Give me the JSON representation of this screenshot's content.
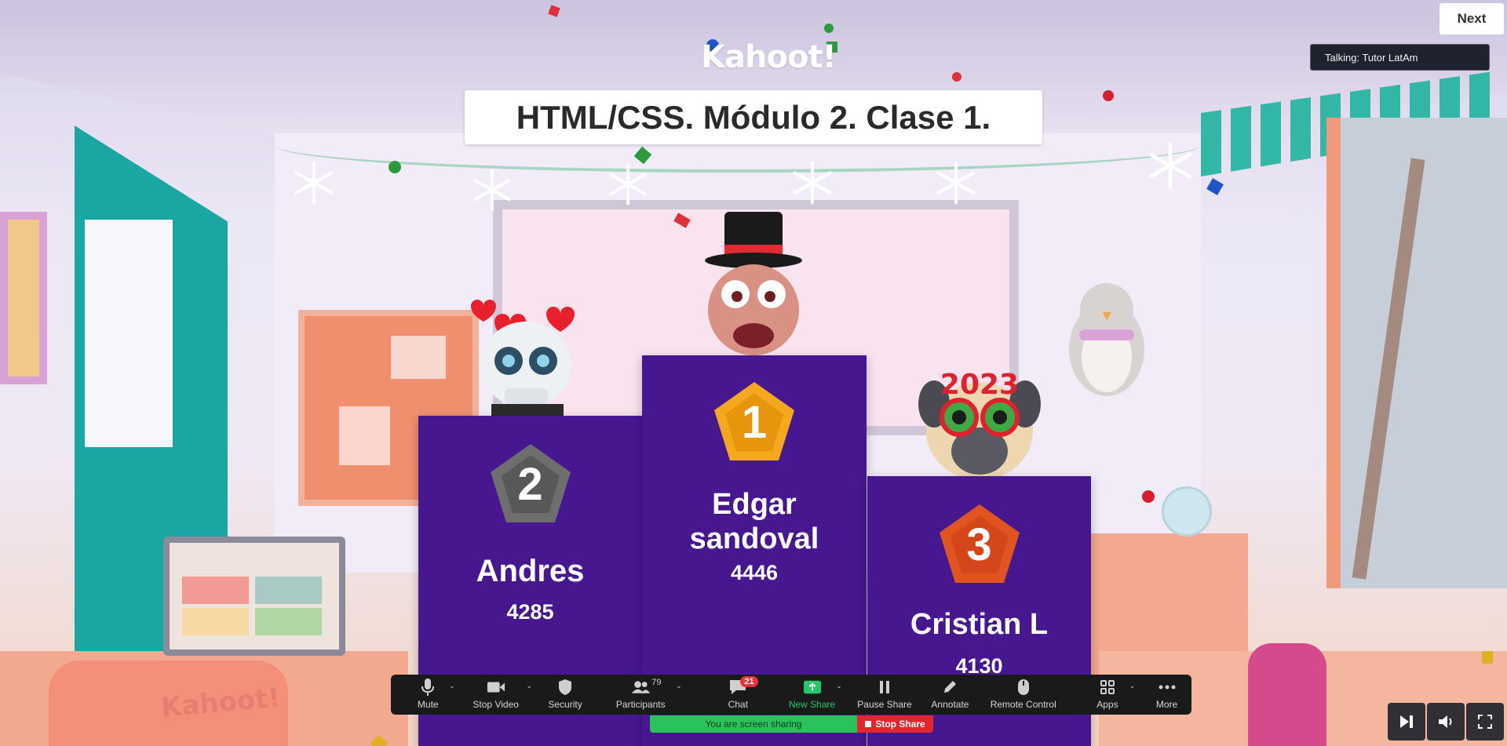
{
  "header": {
    "logo": "Kahoot!",
    "title": "HTML/CSS. Módulo 2. Clase 1.",
    "next_label": "Next",
    "talking": "Talking: Tutor LatAm"
  },
  "podium": {
    "first": {
      "rank": "1",
      "name": "Edgar sandoval",
      "score": "4446",
      "badge_color": "#f3a81e"
    },
    "second": {
      "rank": "2",
      "name": "Andres",
      "score": "4285",
      "badge_color": "#6e6e6e"
    },
    "third": {
      "rank": "3",
      "name": "Cristian L",
      "score": "4130",
      "badge_color": "#e2541f"
    }
  },
  "avatar_text": "2023",
  "chair_text": "Kahoot!",
  "toolbar": {
    "mute": "Mute",
    "stop_video": "Stop Video",
    "security": "Security",
    "participants": "Participants",
    "participants_count": "79",
    "chat": "Chat",
    "chat_count": "21",
    "new_share": "New Share",
    "pause_share": "Pause Share",
    "annotate": "Annotate",
    "remote_control": "Remote Control",
    "apps": "Apps",
    "more": "More"
  },
  "sharing": {
    "status": "You are screen sharing",
    "stop": "Stop Share"
  },
  "colors": {
    "podium": "#46178f",
    "toolbar": "#1a1a1a",
    "share_green": "#2bc25c",
    "stop_red": "#e1262f"
  },
  "icons": [
    "microphone-icon",
    "video-camera-icon",
    "shield-icon",
    "participants-icon",
    "chat-icon",
    "share-arrow-icon",
    "pause-icon",
    "pencil-icon",
    "mouse-icon",
    "apps-icon",
    "ellipsis-icon",
    "skip-icon",
    "speaker-icon",
    "fullscreen-icon"
  ]
}
